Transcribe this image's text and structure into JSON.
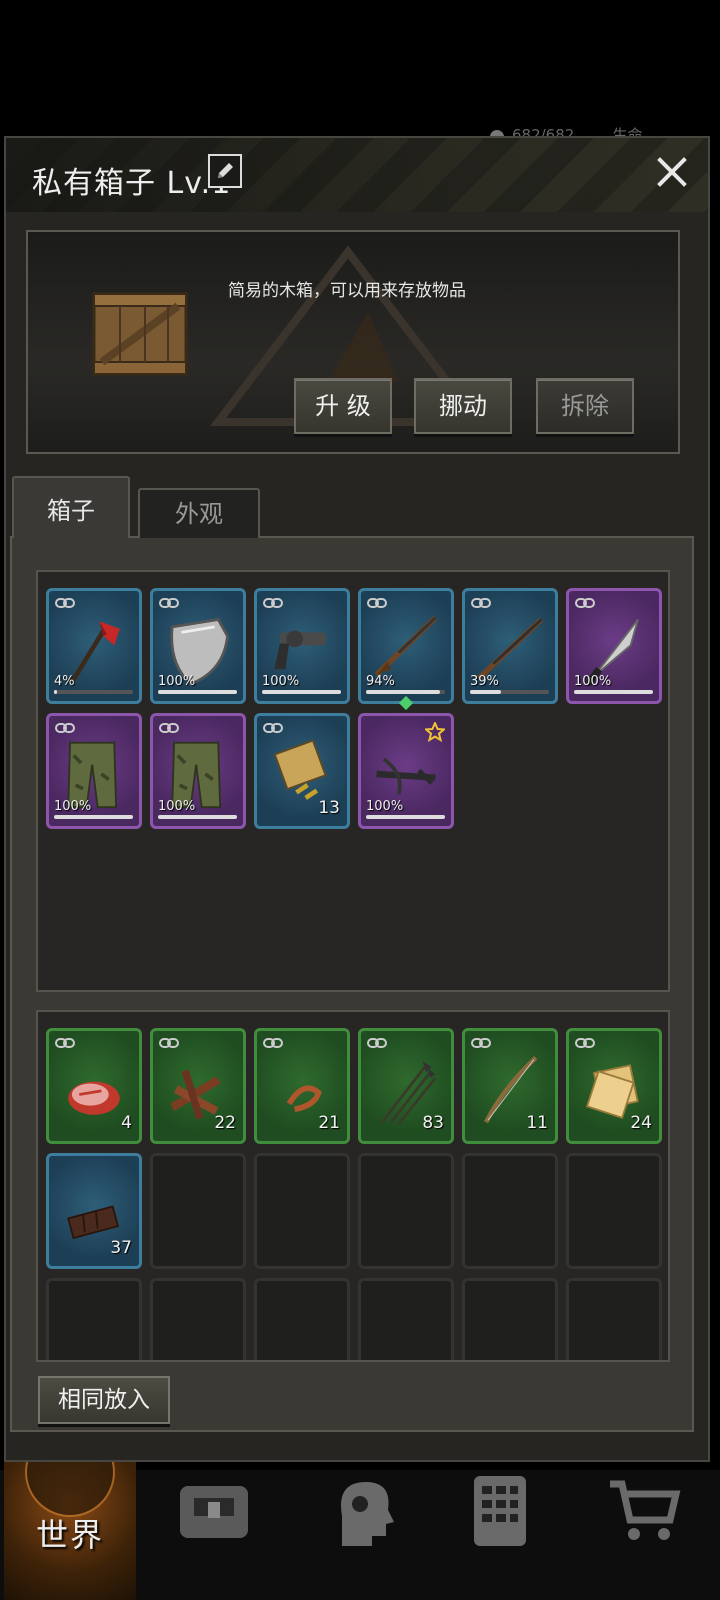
{
  "status_behind": {
    "hp": "682/682",
    "label": "生命"
  },
  "header": {
    "title": "私有箱子 Lv.1"
  },
  "info": {
    "description": "简易的木箱，可以用来存放物品",
    "buttons": {
      "upgrade": "升 级",
      "move": "挪动",
      "dismantle": "拆除"
    }
  },
  "tabs": {
    "box": "箱子",
    "appearance": "外观"
  },
  "equipment": [
    {
      "rarity": "blue",
      "icon": "fire-axe-icon",
      "pct": "4%",
      "durability": 0.04,
      "linked": true
    },
    {
      "rarity": "blue",
      "icon": "metal-shield-icon",
      "pct": "100%",
      "durability": 1.0,
      "linked": true
    },
    {
      "rarity": "blue",
      "icon": "flare-pistol-icon",
      "pct": "100%",
      "durability": 1.0,
      "linked": true
    },
    {
      "rarity": "blue",
      "icon": "hunting-rifle-icon",
      "pct": "94%",
      "durability": 0.94,
      "linked": true
    },
    {
      "rarity": "blue",
      "icon": "shotgun-icon",
      "pct": "39%",
      "durability": 0.39,
      "linked": true
    },
    {
      "rarity": "purple",
      "icon": "combat-knife-icon",
      "pct": "100%",
      "durability": 1.0,
      "linked": true
    },
    {
      "rarity": "purple",
      "icon": "camo-pants-icon",
      "pct": "100%",
      "durability": 1.0,
      "linked": true
    },
    {
      "rarity": "purple",
      "icon": "camo-pants-icon",
      "pct": "100%",
      "durability": 1.0,
      "linked": true
    },
    {
      "rarity": "blue",
      "icon": "ammo-box-icon",
      "qty": "13",
      "linked": true
    },
    {
      "rarity": "purple",
      "icon": "crossbow-icon",
      "pct": "100%",
      "durability": 1.0,
      "starred": true
    }
  ],
  "materials": [
    {
      "rarity": "green",
      "icon": "raw-meat-icon",
      "qty": "4",
      "linked": true
    },
    {
      "rarity": "green",
      "icon": "firewood-icon",
      "qty": "22",
      "linked": true
    },
    {
      "rarity": "green",
      "icon": "rope-icon",
      "qty": "21",
      "linked": true
    },
    {
      "rarity": "green",
      "icon": "arrows-icon",
      "qty": "83",
      "linked": true
    },
    {
      "rarity": "green",
      "icon": "wooden-bow-icon",
      "qty": "11",
      "linked": true
    },
    {
      "rarity": "green",
      "icon": "crackers-icon",
      "qty": "24",
      "linked": true
    },
    {
      "rarity": "blue",
      "icon": "chocolate-icon",
      "qty": "37",
      "linked": false
    }
  ],
  "actions": {
    "same_put_in": "相同放入"
  },
  "nav": {
    "world": "世界"
  },
  "colors": {
    "blue": "#2e5e78",
    "purple": "#6b3c86",
    "green": "#2f6a2e",
    "accent_diamond": "#4ccf6a",
    "star": "#f1c232"
  }
}
